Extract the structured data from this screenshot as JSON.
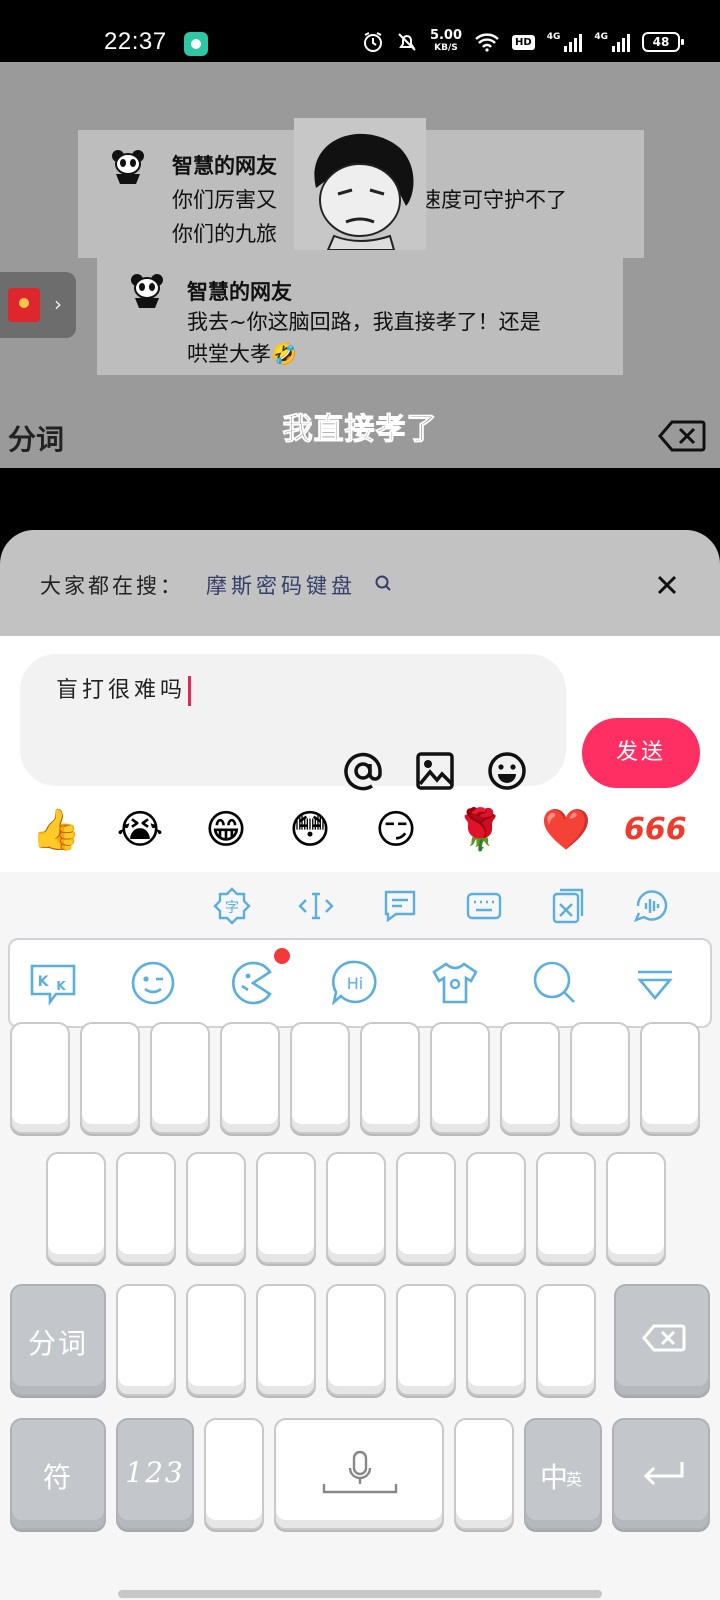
{
  "status_bar": {
    "time": "22:37",
    "net_speed_value": "5.00",
    "net_speed_unit": "KB/S",
    "hd_label": "HD",
    "signal1_label": "4G",
    "signal2_label": "4G",
    "battery": "48"
  },
  "video": {
    "comments": [
      {
        "user": "智慧的网友",
        "line1_left": "你们厉害又",
        "line1_right": "速度可守护不了",
        "line2": "你们的九旅"
      },
      {
        "user": "智慧的网友",
        "line1": "我去~你这脑回路，我直接孝了！还是",
        "line2": "哄堂大孝"
      }
    ],
    "reaction_emoji": "🤣",
    "subtitle": "我直接孝了",
    "segment_label": "分词"
  },
  "search_hint": {
    "label": "大家都在搜：",
    "keyword": "摩斯密码键盘"
  },
  "composer": {
    "input_text": "盲打很难吗",
    "send_label": "发送"
  },
  "emoji_bar": [
    "👍",
    "😭",
    "😁",
    "😳",
    "😏",
    "🌹",
    "❤️",
    "666"
  ],
  "keyboard": {
    "segment_key": "分词",
    "symbol_key": "符",
    "number_key": "123",
    "lang_key_main": "中",
    "lang_key_sub": "英"
  },
  "colors": {
    "send_button": "#ff2e63",
    "keyboard_icon": "#5aaee0",
    "caret": "#e0285a"
  }
}
